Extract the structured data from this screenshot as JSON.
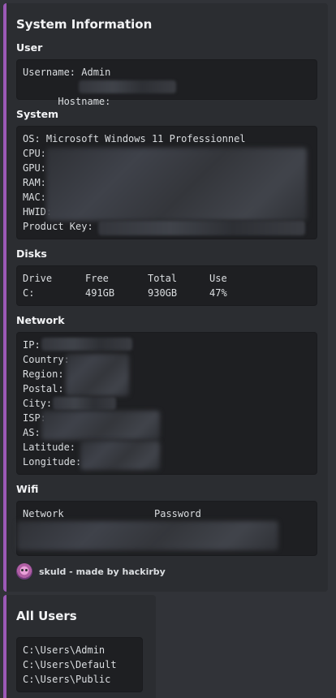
{
  "embed": {
    "title": "System Information",
    "user": {
      "name": "User",
      "lines": [
        "Username: Admin",
        "Hostname: "
      ]
    },
    "system": {
      "name": "System",
      "lines": [
        "OS: Microsoft Windows 11 Professionnel",
        "CPU:",
        "GPU:",
        "RAM:",
        "MAC:",
        "HWID:",
        "Product Key: "
      ]
    },
    "disks": {
      "name": "Disks",
      "headers": [
        "Drive",
        "Free",
        "Total",
        "Use"
      ],
      "rows": [
        [
          "C:",
          "491GB",
          "930GB",
          "47%"
        ]
      ]
    },
    "network": {
      "name": "Network",
      "lines": [
        "IP:",
        "Country:",
        "Region:",
        "Postal:",
        "City:",
        "ISP:",
        "AS:",
        "Latitude:",
        "Longitude:"
      ]
    },
    "wifi": {
      "name": "Wifi",
      "headers": [
        "Network",
        "Password"
      ]
    },
    "footer": {
      "text": "skuld - made by hackirby",
      "icon": "skuld-avatar-icon"
    }
  },
  "users_embed": {
    "title": "All Users",
    "lines": [
      "C:\\Users\\Admin",
      "C:\\Users\\Default",
      "C:\\Users\\Public"
    ]
  },
  "colors": {
    "background": "#313338",
    "embed_background": "#2b2d31",
    "embed_accent": "#9b59b6",
    "code_background": "#1e1f22"
  }
}
